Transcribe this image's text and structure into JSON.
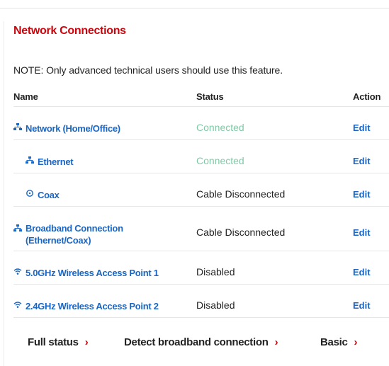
{
  "title": "Network Connections",
  "note": "NOTE: Only advanced technical users should use this feature.",
  "columns": {
    "name": "Name",
    "status": "Status",
    "action": "Action"
  },
  "rows": [
    {
      "name": "Network (Home/Office)",
      "icon": "network-icon",
      "status": "Connected",
      "action": "Edit"
    },
    {
      "name": "Ethernet",
      "icon": "network-icon",
      "status": "Connected",
      "action": "Edit"
    },
    {
      "name": "Coax",
      "icon": "coax-icon",
      "status": "Cable Disconnected",
      "action": "Edit"
    },
    {
      "name_line1": "Broadband Connection",
      "name_line2": "(Ethernet/Coax)",
      "icon": "network-icon",
      "status": "Cable Disconnected",
      "action": "Edit"
    },
    {
      "name": "5.0GHz Wireless Access Point 1",
      "icon": "wifi-icon",
      "status": "Disabled",
      "action": "Edit"
    },
    {
      "name": "2.4GHz Wireless Access Point 2",
      "icon": "wifi-icon",
      "status": "Disabled",
      "action": "Edit"
    }
  ],
  "footer": {
    "full_status": "Full status",
    "detect": "Detect broadband connection",
    "basic": "Basic",
    "chevron": "›"
  },
  "colors": {
    "accent": "#cd040b",
    "link": "#1a66c4",
    "connected": "#7fcaa6"
  }
}
